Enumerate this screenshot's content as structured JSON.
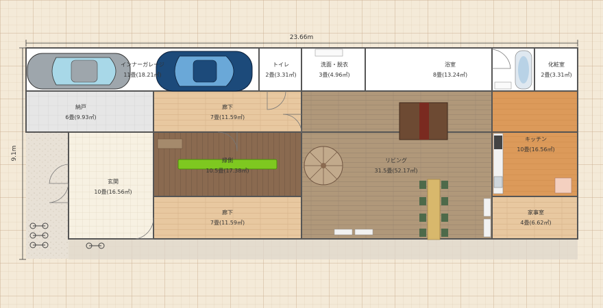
{
  "dimensions": {
    "width": "23.66m",
    "height": "9.1m"
  },
  "rooms": {
    "garage": {
      "name": "インナーガレージ",
      "area": "11畳(18.21㎡)"
    },
    "toilet": {
      "name": "トイレ",
      "area": "2畳(3.31㎡)"
    },
    "washroom": {
      "name": "洗面・脱衣",
      "area": "3畳(4.96㎡)"
    },
    "bath": {
      "name": "浴室",
      "area": "8畳(13.24㎡)"
    },
    "powder": {
      "name": "化粧室",
      "area": "2畳(3.31㎡)"
    },
    "storage": {
      "name": "納戸",
      "area": "6畳(9.93㎡)"
    },
    "hall1": {
      "name": "廊下",
      "area": "7畳(11.59㎡)"
    },
    "engawa": {
      "name": "縁側",
      "area": "10.5畳(17.38㎡)"
    },
    "entrance": {
      "name": "玄関",
      "area": "10畳(16.56㎡)"
    },
    "hall2": {
      "name": "廊下",
      "area": "7畳(11.59㎡)"
    },
    "living": {
      "name": "リビング",
      "area": "31.5畳(52.17㎡)"
    },
    "kitchen": {
      "name": "キッチン",
      "area": "10畳(16.56㎡)"
    },
    "housework": {
      "name": "家事室",
      "area": "4畳(6.62㎡)"
    }
  },
  "colors": {
    "wall": "#555555",
    "wood_light": "#e8c8a0",
    "wood_dark": "#8a6a50",
    "living_floor": "#b0987a",
    "tile_gray": "#e6e6e6",
    "entrance_tile": "#f7f1e2",
    "kitchen_floor": "#dc9a5a",
    "car_white": "#a8d8e8",
    "car_blue": "#1c4a7a",
    "plant_green": "#7ec820"
  },
  "icons": [
    "car-icon",
    "bicycle-icon",
    "spiral-stair-icon",
    "dining-table-icon",
    "bathtub-icon",
    "toilet-icon",
    "sink-icon",
    "stove-icon"
  ]
}
